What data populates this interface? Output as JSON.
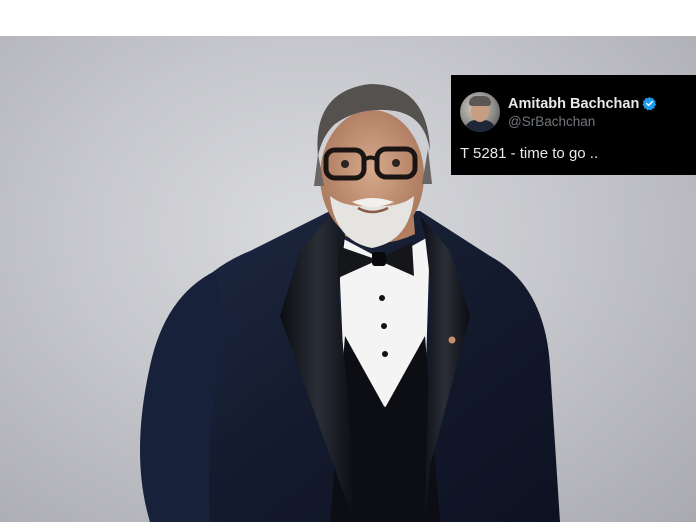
{
  "tweet": {
    "display_name": "Amitabh Bachchan",
    "handle": "@SrBachchan",
    "text": "T 5281 - time to go ..",
    "verified": true,
    "verified_color": "#1d9bf0"
  },
  "photo": {
    "icon": "portrait-photo"
  }
}
